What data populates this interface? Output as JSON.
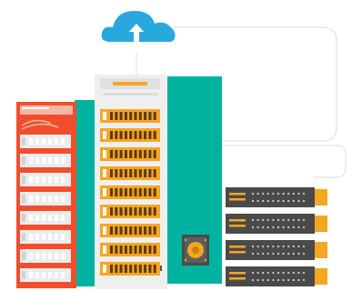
{
  "colors": {
    "cloud": "#29a8e0",
    "arrow": "#ffffff",
    "tower_teal": "#00b3a0",
    "server_red": "#f04e2d",
    "server_gray": "#ececec",
    "drive_orange": "#f5a623",
    "rack_dark": "#4a4a4a",
    "connector_line": "#e0e0e0"
  },
  "icons": {
    "cloud": "cloud-upload-icon",
    "fan": "cooling-fan-icon"
  },
  "counts": {
    "red_server_slots": 9,
    "gray_tower_drives": 9,
    "rack_units": 4
  }
}
